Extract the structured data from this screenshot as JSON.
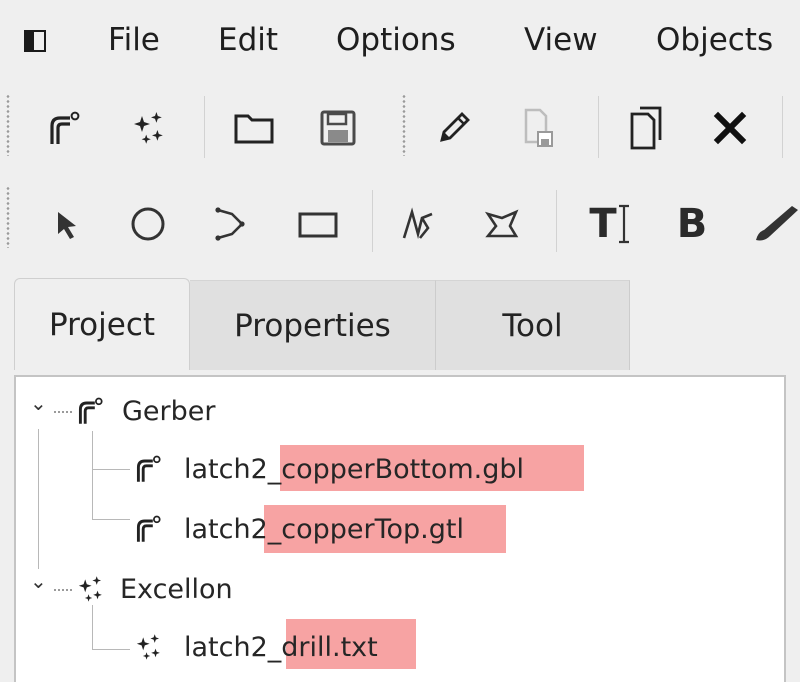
{
  "menubar": {
    "items": [
      "File",
      "Edit",
      "Options",
      "View",
      "Objects"
    ]
  },
  "toolbar1": {
    "icons": [
      "gerber-icon",
      "excellon-icon",
      "open-folder-icon",
      "save-icon",
      "pencil-icon",
      "save-as-icon",
      "copy-icon",
      "delete-icon"
    ]
  },
  "toolbar2": {
    "icons": [
      "select-arrow-icon",
      "circle-icon",
      "polygon-icon",
      "rectangle-icon",
      "path-icon",
      "polygon-tool-icon",
      "text-icon",
      "bold-icon",
      "paint-icon"
    ],
    "text_tool_label": "T",
    "bold_label": "B"
  },
  "tabs": [
    {
      "label": "Project",
      "active": true
    },
    {
      "label": "Properties",
      "active": false
    },
    {
      "label": "Tool",
      "active": false
    }
  ],
  "tree": {
    "groups": [
      {
        "label": "Gerber",
        "expander": "⌄",
        "icon": "gerber-icon",
        "children": [
          {
            "label": "latch2_copperBottom.gbl",
            "icon": "gerber-icon"
          },
          {
            "label": "latch2_copperTop.gtl",
            "icon": "gerber-icon"
          }
        ]
      },
      {
        "label": "Excellon",
        "expander": "⌄",
        "icon": "excellon-icon",
        "children": [
          {
            "label": "latch2_drill.txt",
            "icon": "excellon-icon"
          }
        ]
      }
    ]
  },
  "colors": {
    "highlight": "#f7a3a3",
    "background": "#efefef"
  }
}
